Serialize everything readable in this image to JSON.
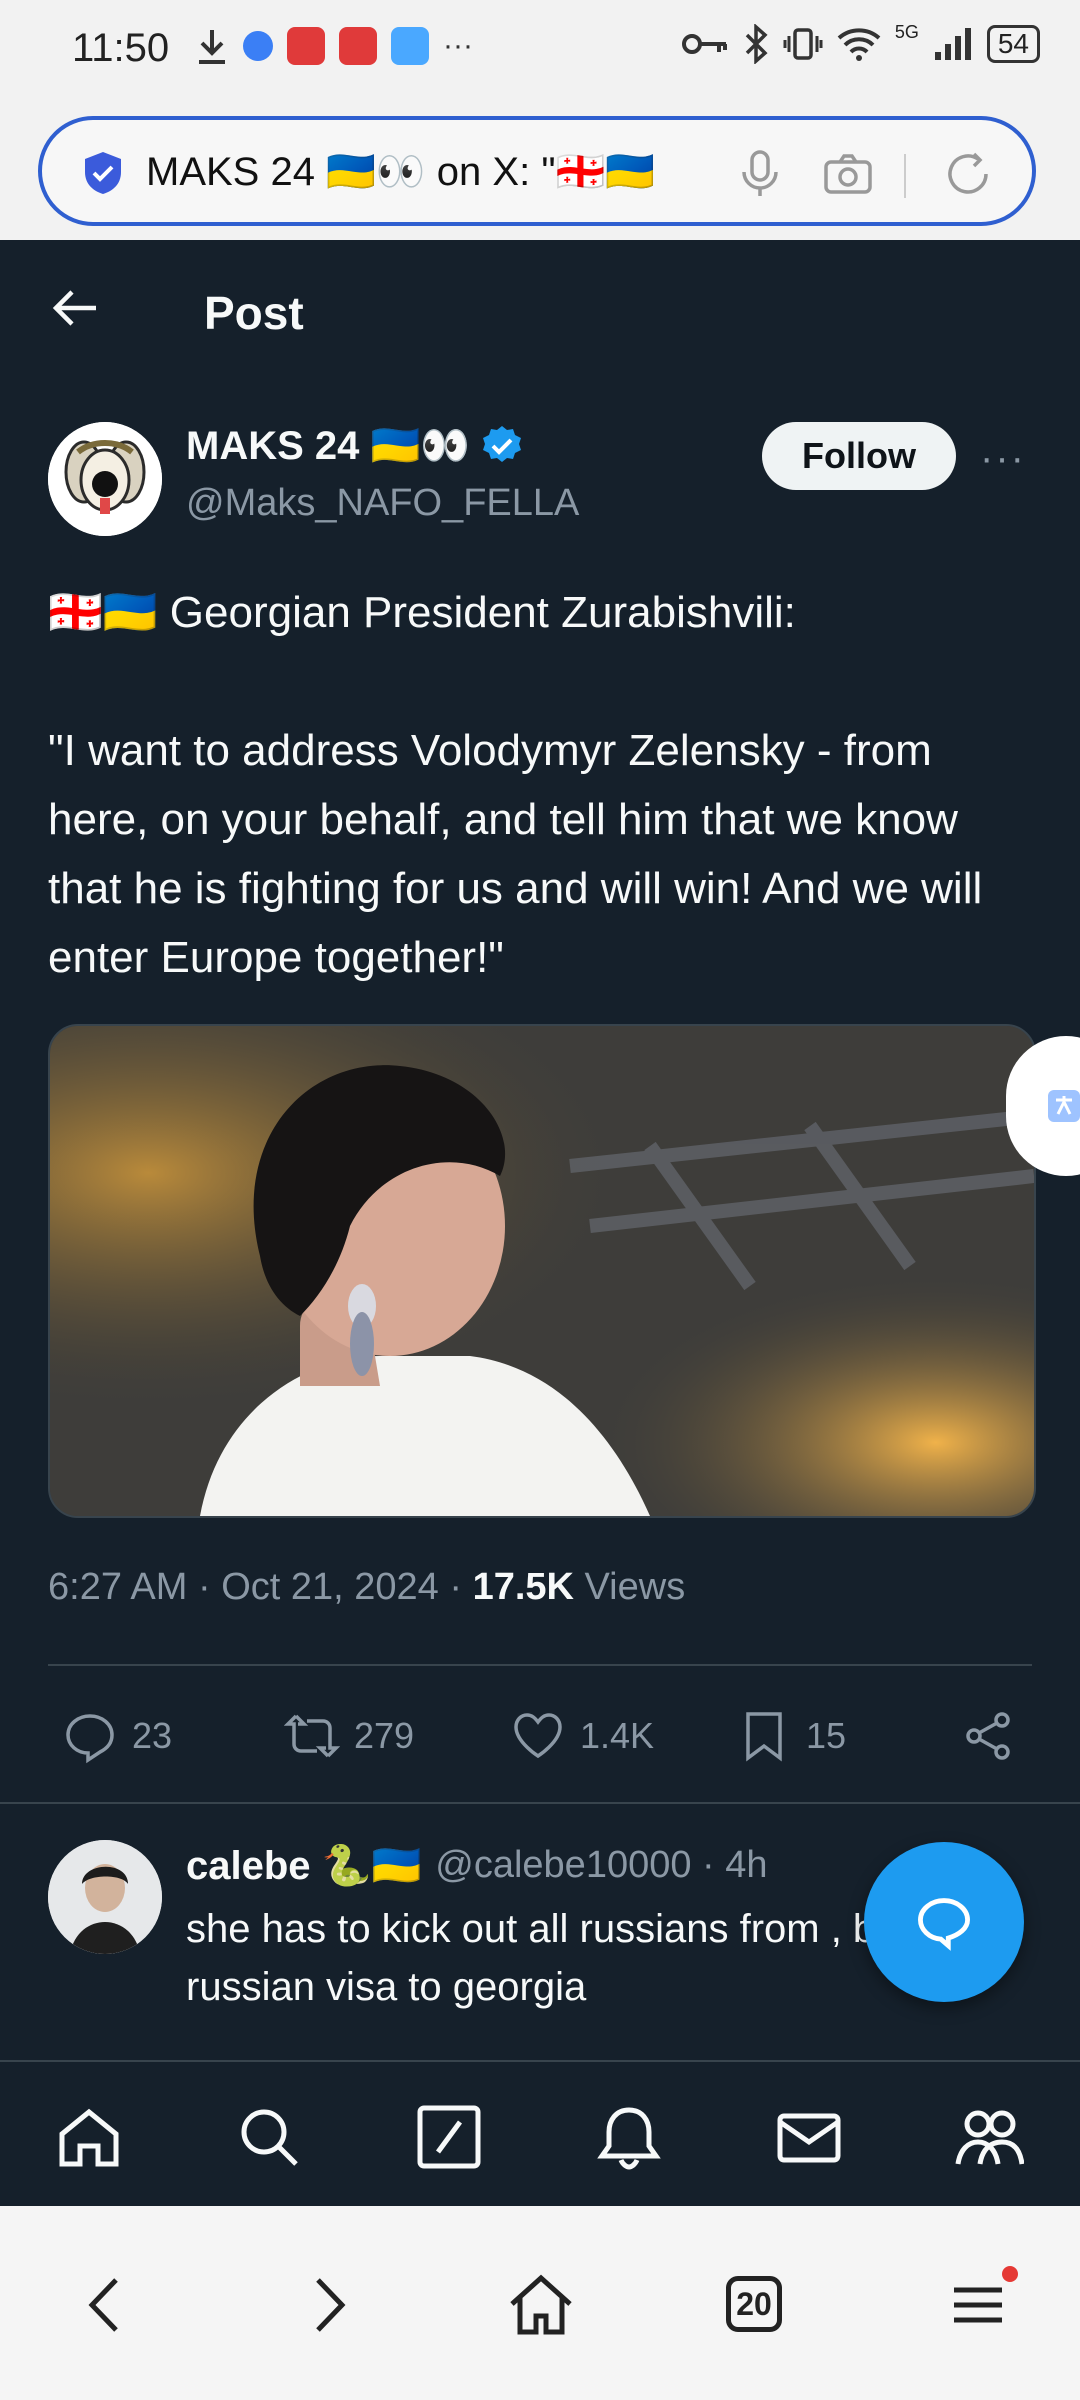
{
  "status_bar": {
    "time": "11:50",
    "network": "5G",
    "battery": "54",
    "overflow": "···"
  },
  "url_bar": {
    "text": "MAKS 24 🇺🇦👀 on X: \"🇬🇪🇺🇦"
  },
  "header": {
    "title": "Post"
  },
  "post": {
    "author_name": "MAKS 24 🇺🇦👀",
    "author_handle": "@Maks_NAFO_FELLA",
    "follow_label": "Follow",
    "more_label": "···",
    "text_line1": "🇬🇪🇺🇦 Georgian President Zurabishvili:",
    "text_quote": "\"I want to address Volodymyr Zelensky - from here, on your behalf, and tell him that we know that he is fighting for us and will win! And we will enter Europe together!\"",
    "timestamp": "6:27 AM · Oct 21, 2024 · ",
    "views_count": "17.5K",
    "views_label": " Views",
    "replies": "23",
    "reposts": "279",
    "likes": "1.4K",
    "bookmarks": "15"
  },
  "reply": {
    "name": "calebe 🐍🇺🇦",
    "meta": "@calebe10000 · 4h",
    "text": "she has to kick out all russians from , ban free russian visa to georgia"
  },
  "browser_bar": {
    "tabs_count": "20"
  },
  "colors": {
    "background": "#15202b",
    "accent": "#1d9bf0",
    "verified": "#1d9bf0"
  }
}
